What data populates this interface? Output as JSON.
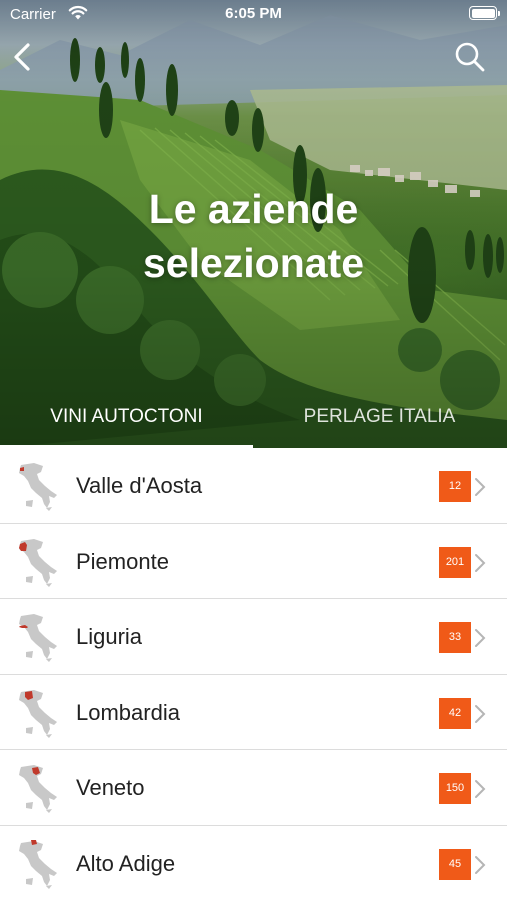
{
  "status_bar": {
    "carrier": "Carrier",
    "time": "6:05 PM"
  },
  "nav": {
    "back_icon": "chevron-left-icon",
    "search_icon": "search-icon"
  },
  "hero": {
    "title_line1": "Le aziende",
    "title_line2": "selezionate"
  },
  "tabs": [
    {
      "label": "VINI AUTOCTONI",
      "active": true
    },
    {
      "label": "PERLAGE ITALIA",
      "active": false
    }
  ],
  "regions": [
    {
      "name": "Valle d'Aosta",
      "count": "12",
      "map_icon": "italy-map-icon"
    },
    {
      "name": "Piemonte",
      "count": "201",
      "map_icon": "italy-map-icon"
    },
    {
      "name": "Liguria",
      "count": "33",
      "map_icon": "italy-map-icon"
    },
    {
      "name": "Lombardia",
      "count": "42",
      "map_icon": "italy-map-icon"
    },
    {
      "name": "Veneto",
      "count": "150",
      "map_icon": "italy-map-icon"
    },
    {
      "name": "Alto Adige",
      "count": "45",
      "map_icon": "italy-map-icon"
    }
  ],
  "colors": {
    "badge": "#f05a18",
    "highlight_region": "#c0392b",
    "map_gray": "#c8c8c8"
  }
}
